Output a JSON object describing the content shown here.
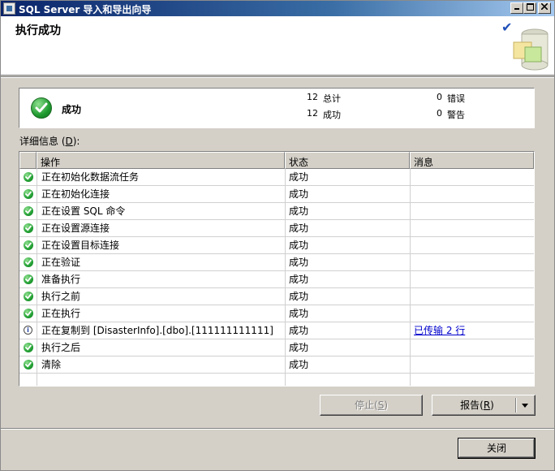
{
  "window": {
    "title": "SQL Server 导入和导出向导"
  },
  "header": {
    "title": "执行成功"
  },
  "summary": {
    "status": "成功",
    "total_count": "12",
    "total_label": "总计",
    "success_count": "12",
    "success_label": "成功",
    "error_count": "0",
    "error_label": "错误",
    "warning_count": "0",
    "warning_label": "警告"
  },
  "details": {
    "label_prefix": "详细信息 (",
    "label_key": "D",
    "label_suffix": "):",
    "columns": {
      "action": "操作",
      "status": "状态",
      "message": "消息"
    },
    "rows": [
      {
        "icon": "success-icon",
        "action": "正在初始化数据流任务",
        "status": "成功",
        "message": ""
      },
      {
        "icon": "success-icon",
        "action": "正在初始化连接",
        "status": "成功",
        "message": ""
      },
      {
        "icon": "success-icon",
        "action": "正在设置 SQL 命令",
        "status": "成功",
        "message": ""
      },
      {
        "icon": "success-icon",
        "action": "正在设置源连接",
        "status": "成功",
        "message": ""
      },
      {
        "icon": "success-icon",
        "action": "正在设置目标连接",
        "status": "成功",
        "message": ""
      },
      {
        "icon": "success-icon",
        "action": "正在验证",
        "status": "成功",
        "message": ""
      },
      {
        "icon": "success-icon",
        "action": "准备执行",
        "status": "成功",
        "message": ""
      },
      {
        "icon": "success-icon",
        "action": "执行之前",
        "status": "成功",
        "message": ""
      },
      {
        "icon": "success-icon",
        "action": "正在执行",
        "status": "成功",
        "message": ""
      },
      {
        "icon": "info-icon",
        "action": "正在复制到 [DisasterInfo].[dbo].[111111111111]",
        "status": "成功",
        "message": "已传输 2 行"
      },
      {
        "icon": "success-icon",
        "action": "执行之后",
        "status": "成功",
        "message": ""
      },
      {
        "icon": "success-icon",
        "action": "清除",
        "status": "成功",
        "message": ""
      }
    ]
  },
  "buttons": {
    "stop": {
      "label": "停止",
      "key": "S"
    },
    "report": {
      "label": "报告",
      "key": "R"
    },
    "close": {
      "label": "关闭"
    }
  }
}
